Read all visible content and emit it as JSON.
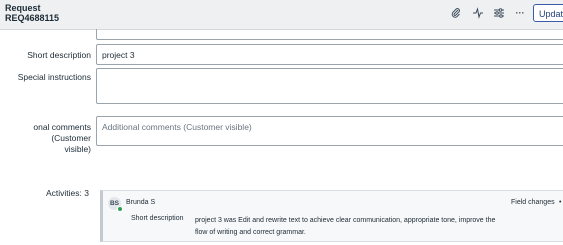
{
  "header": {
    "record_type": "Request",
    "record_number": "REQ4688115",
    "icons": [
      "paperclip-icon",
      "activity-icon",
      "settings-sliders-icon",
      "more-icon"
    ],
    "more_label": "···",
    "update_label": "Update"
  },
  "form": {
    "short_description": {
      "label": "Short description",
      "value": "project 3"
    },
    "special_instructions": {
      "label": "Special instructions",
      "value": ""
    },
    "additional_comments": {
      "label_line1": "onal comments (Customer",
      "label_line2": "visible)",
      "placeholder": "Additional comments (Customer visible)"
    }
  },
  "activities": {
    "label": "Activities: 3",
    "entries": [
      {
        "initials": "BS",
        "user": "Brunda S",
        "type": "Field changes",
        "field": "Short description",
        "value": "project 3  was  Edit and rewrite text to achieve clear communication, appropriate tone, improve the flow of writing and correct grammar."
      }
    ]
  }
}
